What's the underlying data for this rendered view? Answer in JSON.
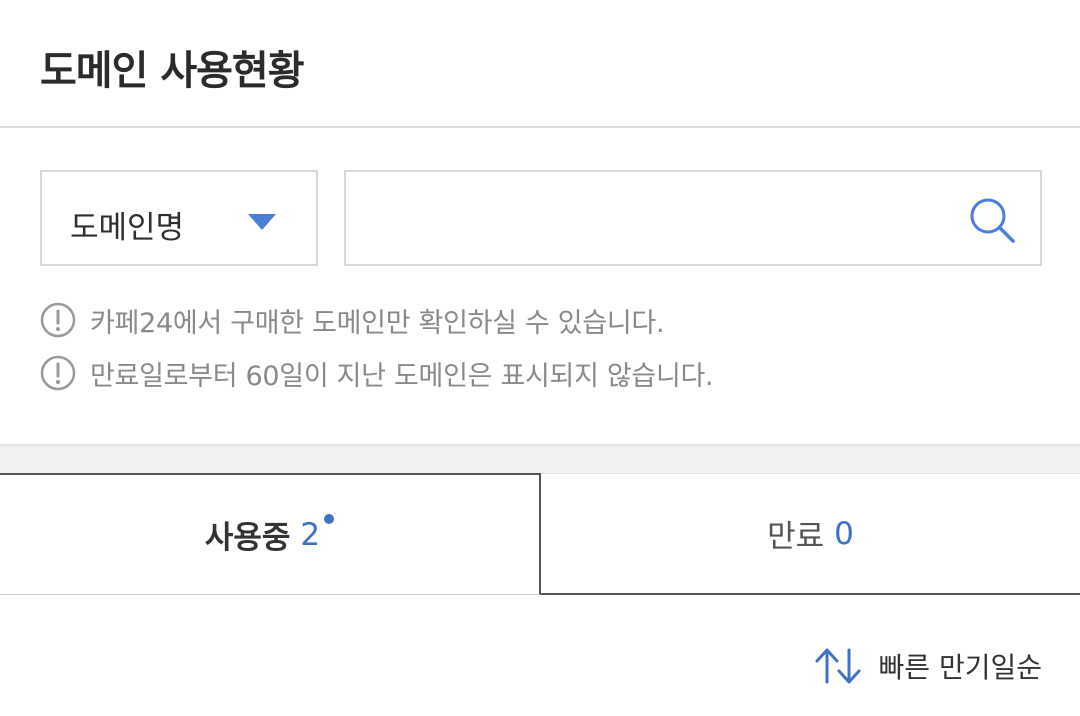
{
  "header": {
    "title": "도메인 사용현황"
  },
  "search": {
    "select_label": "도메인명",
    "input_value": "",
    "input_placeholder": ""
  },
  "notices": [
    "카페24에서 구매한 도메인만 확인하실 수 있습니다.",
    "만료일로부터 60일이 지난 도메인은 표시되지 않습니다."
  ],
  "tabs": [
    {
      "label": "사용중",
      "count": "2",
      "active": true,
      "has_new_dot": true
    },
    {
      "label": "만료",
      "count": "0",
      "active": false
    }
  ],
  "sort": {
    "label": "빠른 만기일순"
  },
  "colors": {
    "accent": "#3f72c5",
    "caret": "#4a7fd6",
    "muted_text": "#8a8a8a"
  },
  "icons": {
    "search": "search-icon",
    "notice": "exclamation-circle-icon",
    "sort": "sort-arrows-icon",
    "select": "caret-down-icon"
  }
}
